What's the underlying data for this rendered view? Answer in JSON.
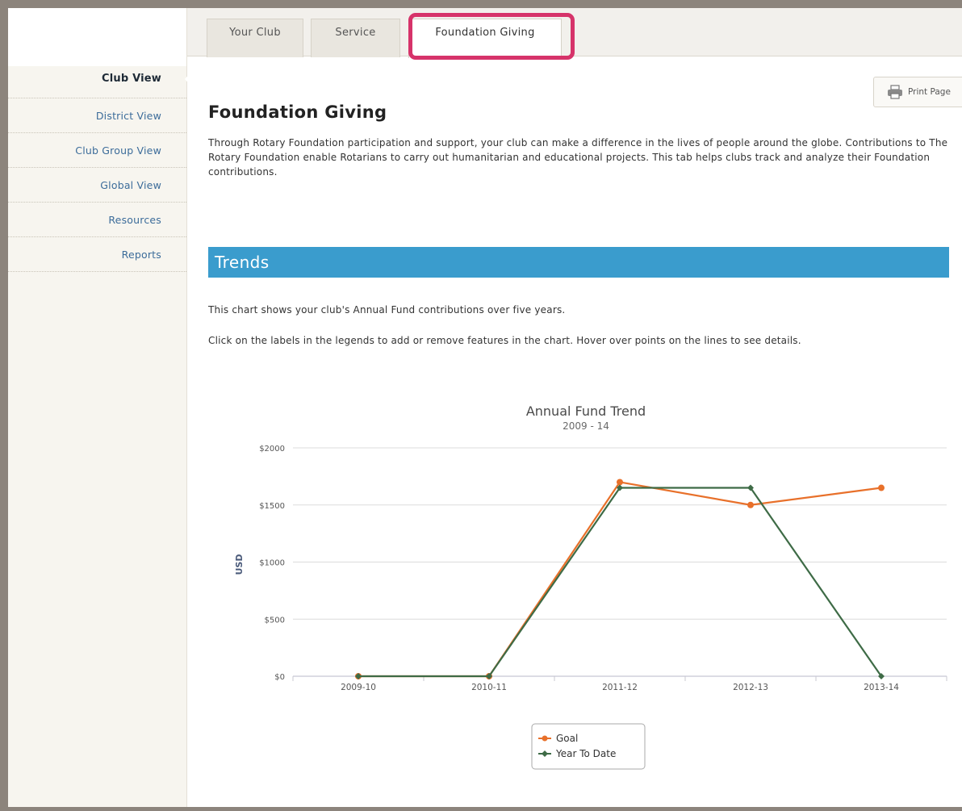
{
  "sidebar": {
    "items": [
      {
        "label": "Club View",
        "active": true
      },
      {
        "label": "District View",
        "active": false
      },
      {
        "label": "Club Group View",
        "active": false
      },
      {
        "label": "Global View",
        "active": false
      },
      {
        "label": "Resources",
        "active": false
      },
      {
        "label": "Reports",
        "active": false
      }
    ]
  },
  "tabs": [
    {
      "label": "Your Club"
    },
    {
      "label": "Service"
    },
    {
      "label": "Foundation Giving",
      "selected": true
    }
  ],
  "toolbar": {
    "print_label": "Print Page",
    "print_icon": "printer-icon"
  },
  "page": {
    "title": "Foundation Giving",
    "intro": "Through Rotary Foundation participation and support, your club can make a difference in the lives of people around the globe. Contributions to The Rotary Foundation enable Rotarians to carry out humanitarian and educational projects. This tab helps clubs track and analyze their Foundation contributions."
  },
  "trends": {
    "heading": "Trends",
    "desc1": "This chart shows your club's Annual Fund contributions over five years.",
    "desc2": "Click on the labels in the legends to add or remove features in the chart. Hover over points on the lines to see details."
  },
  "colors": {
    "accent_blue": "#3a9ccd",
    "highlight_pink": "#d6336a",
    "goal_series": "#e8702a",
    "ytd_series": "#3e6b46",
    "link_blue": "#3c6c9a"
  },
  "chart_data": {
    "type": "line",
    "title": "Annual Fund Trend",
    "subtitle": "2009 - 14",
    "xlabel": "",
    "ylabel": "USD",
    "categories": [
      "2009-10",
      "2010-11",
      "2011-12",
      "2012-13",
      "2013-14"
    ],
    "ylim": [
      0,
      2000
    ],
    "yticks": [
      0,
      500,
      1000,
      1500,
      2000
    ],
    "ytick_labels": [
      "$0",
      "$500",
      "$1000",
      "$1500",
      "$2000"
    ],
    "grid": true,
    "legend_position": "bottom-center",
    "series": [
      {
        "name": "Goal",
        "color": "#e8702a",
        "values": [
          0,
          0,
          1700,
          1500,
          1650
        ]
      },
      {
        "name": "Year To Date",
        "color": "#3e6b46",
        "values": [
          0,
          0,
          1650,
          1650,
          0
        ]
      }
    ]
  }
}
